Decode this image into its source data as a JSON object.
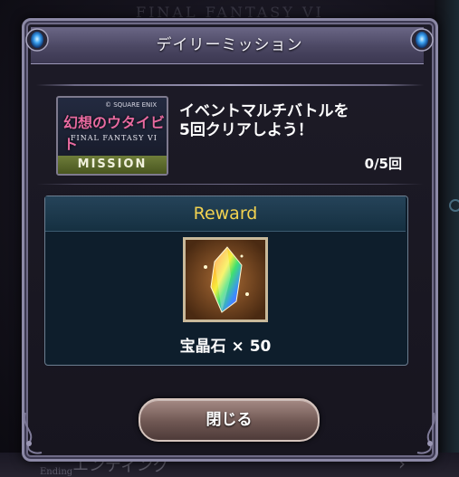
{
  "background": {
    "title": "FINAL FANTASY VI",
    "bottom_item": "エンディング",
    "bottom_sub": "Ending"
  },
  "dialog": {
    "title": "デイリーミッション",
    "mission": {
      "banner": {
        "copyright": "© SQUARE ENIX",
        "logo_text": "幻想のウタイビト",
        "game_title": "FINAL FANTASY VI",
        "tag": "MISSION"
      },
      "description": "イベントマルチバトルを\n5回クリアしよう！",
      "progress": "0/5回"
    },
    "reward": {
      "header": "Reward",
      "item_icon": "rainbow-crystal-icon",
      "item_label": "宝晶石 × 50"
    },
    "close_button": "閉じる"
  },
  "colors": {
    "reward_header_text": "#f2d250",
    "mission_tag": "#6e7d3a",
    "frame": "#8c89a6"
  }
}
